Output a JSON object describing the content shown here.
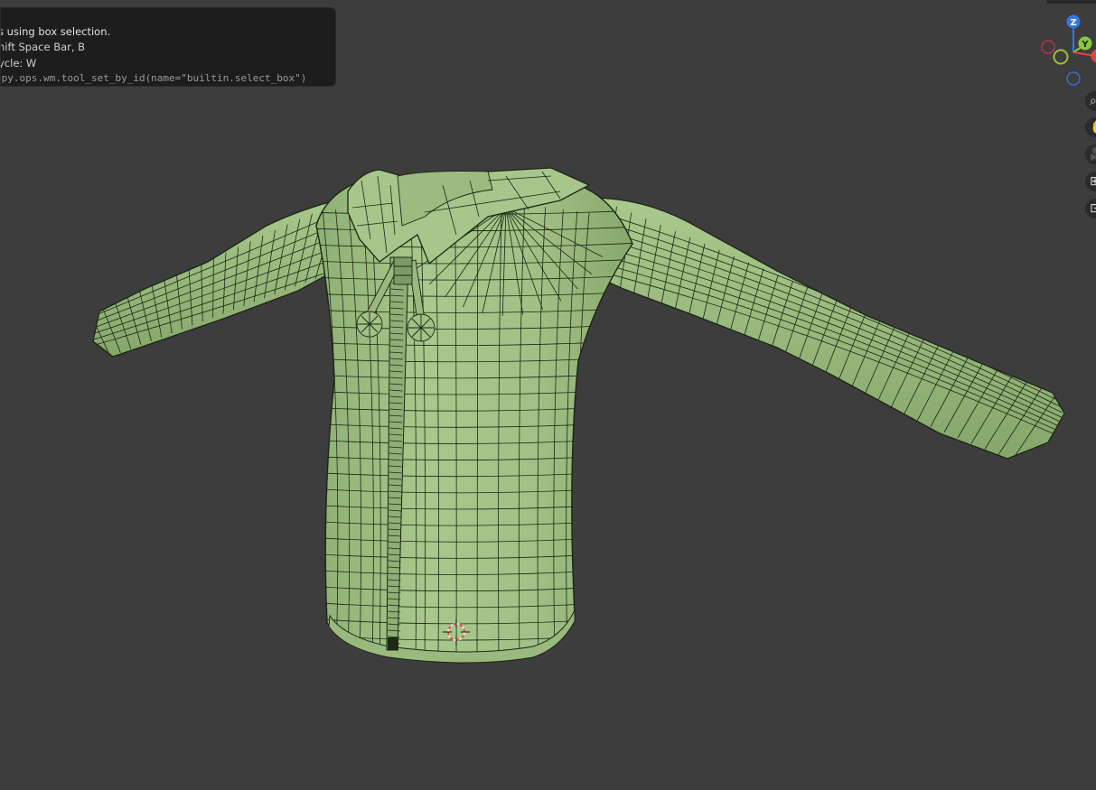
{
  "tooltip": {
    "line1": "s using box selection.",
    "line2": "hift Space Bar, B",
    "line3": "ycle: W",
    "line4": "ppy.ops.wm.tool_set_by_id(name=\"builtin.select_box\")"
  },
  "gizmo": {
    "z_label": "Z",
    "y_label": "Y",
    "colors": {
      "z": "#2f79e8",
      "y": "#8cc63e",
      "x": "#e8443a"
    }
  },
  "nav_buttons": [
    {
      "name": "zoom",
      "glyph": "⌕"
    },
    {
      "name": "pan",
      "glyph": "✋"
    },
    {
      "name": "camera",
      "glyph": "🎥"
    },
    {
      "name": "perspective",
      "glyph": "⊞"
    },
    {
      "name": "quad",
      "glyph": "⊡"
    }
  ],
  "mesh": {
    "fill": "#a3c286",
    "wire": "#1b2614"
  },
  "cursor": {
    "name": "3d-cursor"
  }
}
